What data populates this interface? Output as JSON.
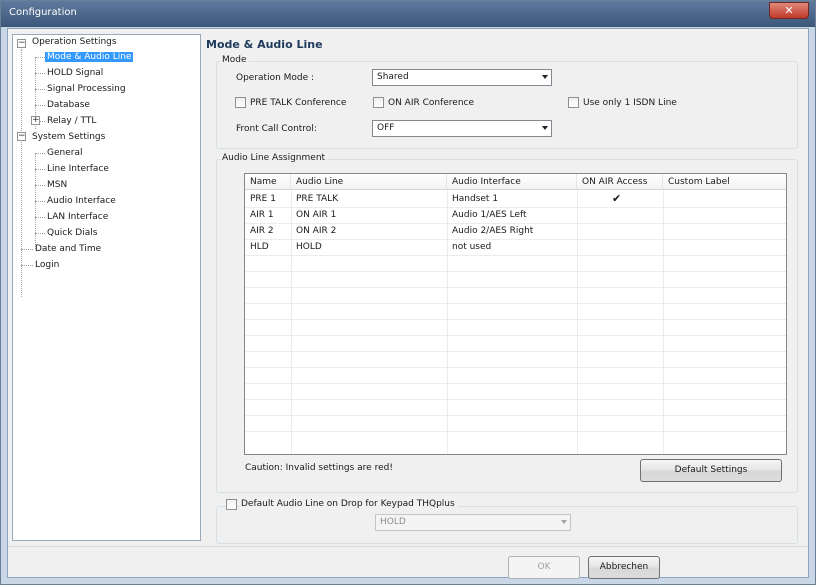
{
  "window": {
    "title": "Configuration"
  },
  "tree": {
    "operation_settings": "Operation Settings",
    "mode_audio_line": "Mode & Audio Line",
    "hold_signal": "HOLD Signal",
    "signal_processing": "Signal Processing",
    "database": "Database",
    "relay_ttl": "Relay / TTL",
    "system_settings": "System Settings",
    "general": "General",
    "line_interface": "Line Interface",
    "msn": "MSN",
    "audio_interface": "Audio Interface",
    "lan_interface": "LAN Interface",
    "quick_dials": "Quick Dials",
    "date_time": "Date and Time",
    "login": "Login"
  },
  "pane": {
    "title": "Mode & Audio Line",
    "mode_group": "Mode",
    "operation_mode_label": "Operation Mode :",
    "operation_mode_value": "Shared",
    "pre_talk_conference": "PRE TALK Conference",
    "on_air_conference": "ON AIR Conference",
    "use_only_isdn": "Use only 1 ISDN Line",
    "front_call_control_label": "Front Call Control:",
    "front_call_control_value": "OFF",
    "assignment_group": "Audio Line Assignment",
    "caution": "Caution: Invalid settings are red!",
    "default_settings": "Default Settings",
    "default_audio_line_label": "Default Audio Line on Drop for Keypad THQplus",
    "default_audio_line_value": "HOLD"
  },
  "table": {
    "headers": [
      "Name",
      "Audio Line",
      "Audio Interface",
      "ON AIR Access",
      "Custom Label"
    ],
    "rows": [
      {
        "name": "PRE 1",
        "audio_line": "PRE TALK",
        "audio_interface": "Handset 1",
        "on_air_access": "✔",
        "custom_label": ""
      },
      {
        "name": "AIR 1",
        "audio_line": "ON AIR 1",
        "audio_interface": "Audio 1/AES Left",
        "on_air_access": "",
        "custom_label": ""
      },
      {
        "name": "AIR 2",
        "audio_line": "ON AIR 2",
        "audio_interface": "Audio 2/AES Right",
        "on_air_access": "",
        "custom_label": ""
      },
      {
        "name": "HLD",
        "audio_line": "HOLD",
        "audio_interface": "not used",
        "on_air_access": "",
        "custom_label": ""
      }
    ]
  },
  "footer": {
    "ok": "OK",
    "cancel": "Abbrechen"
  }
}
